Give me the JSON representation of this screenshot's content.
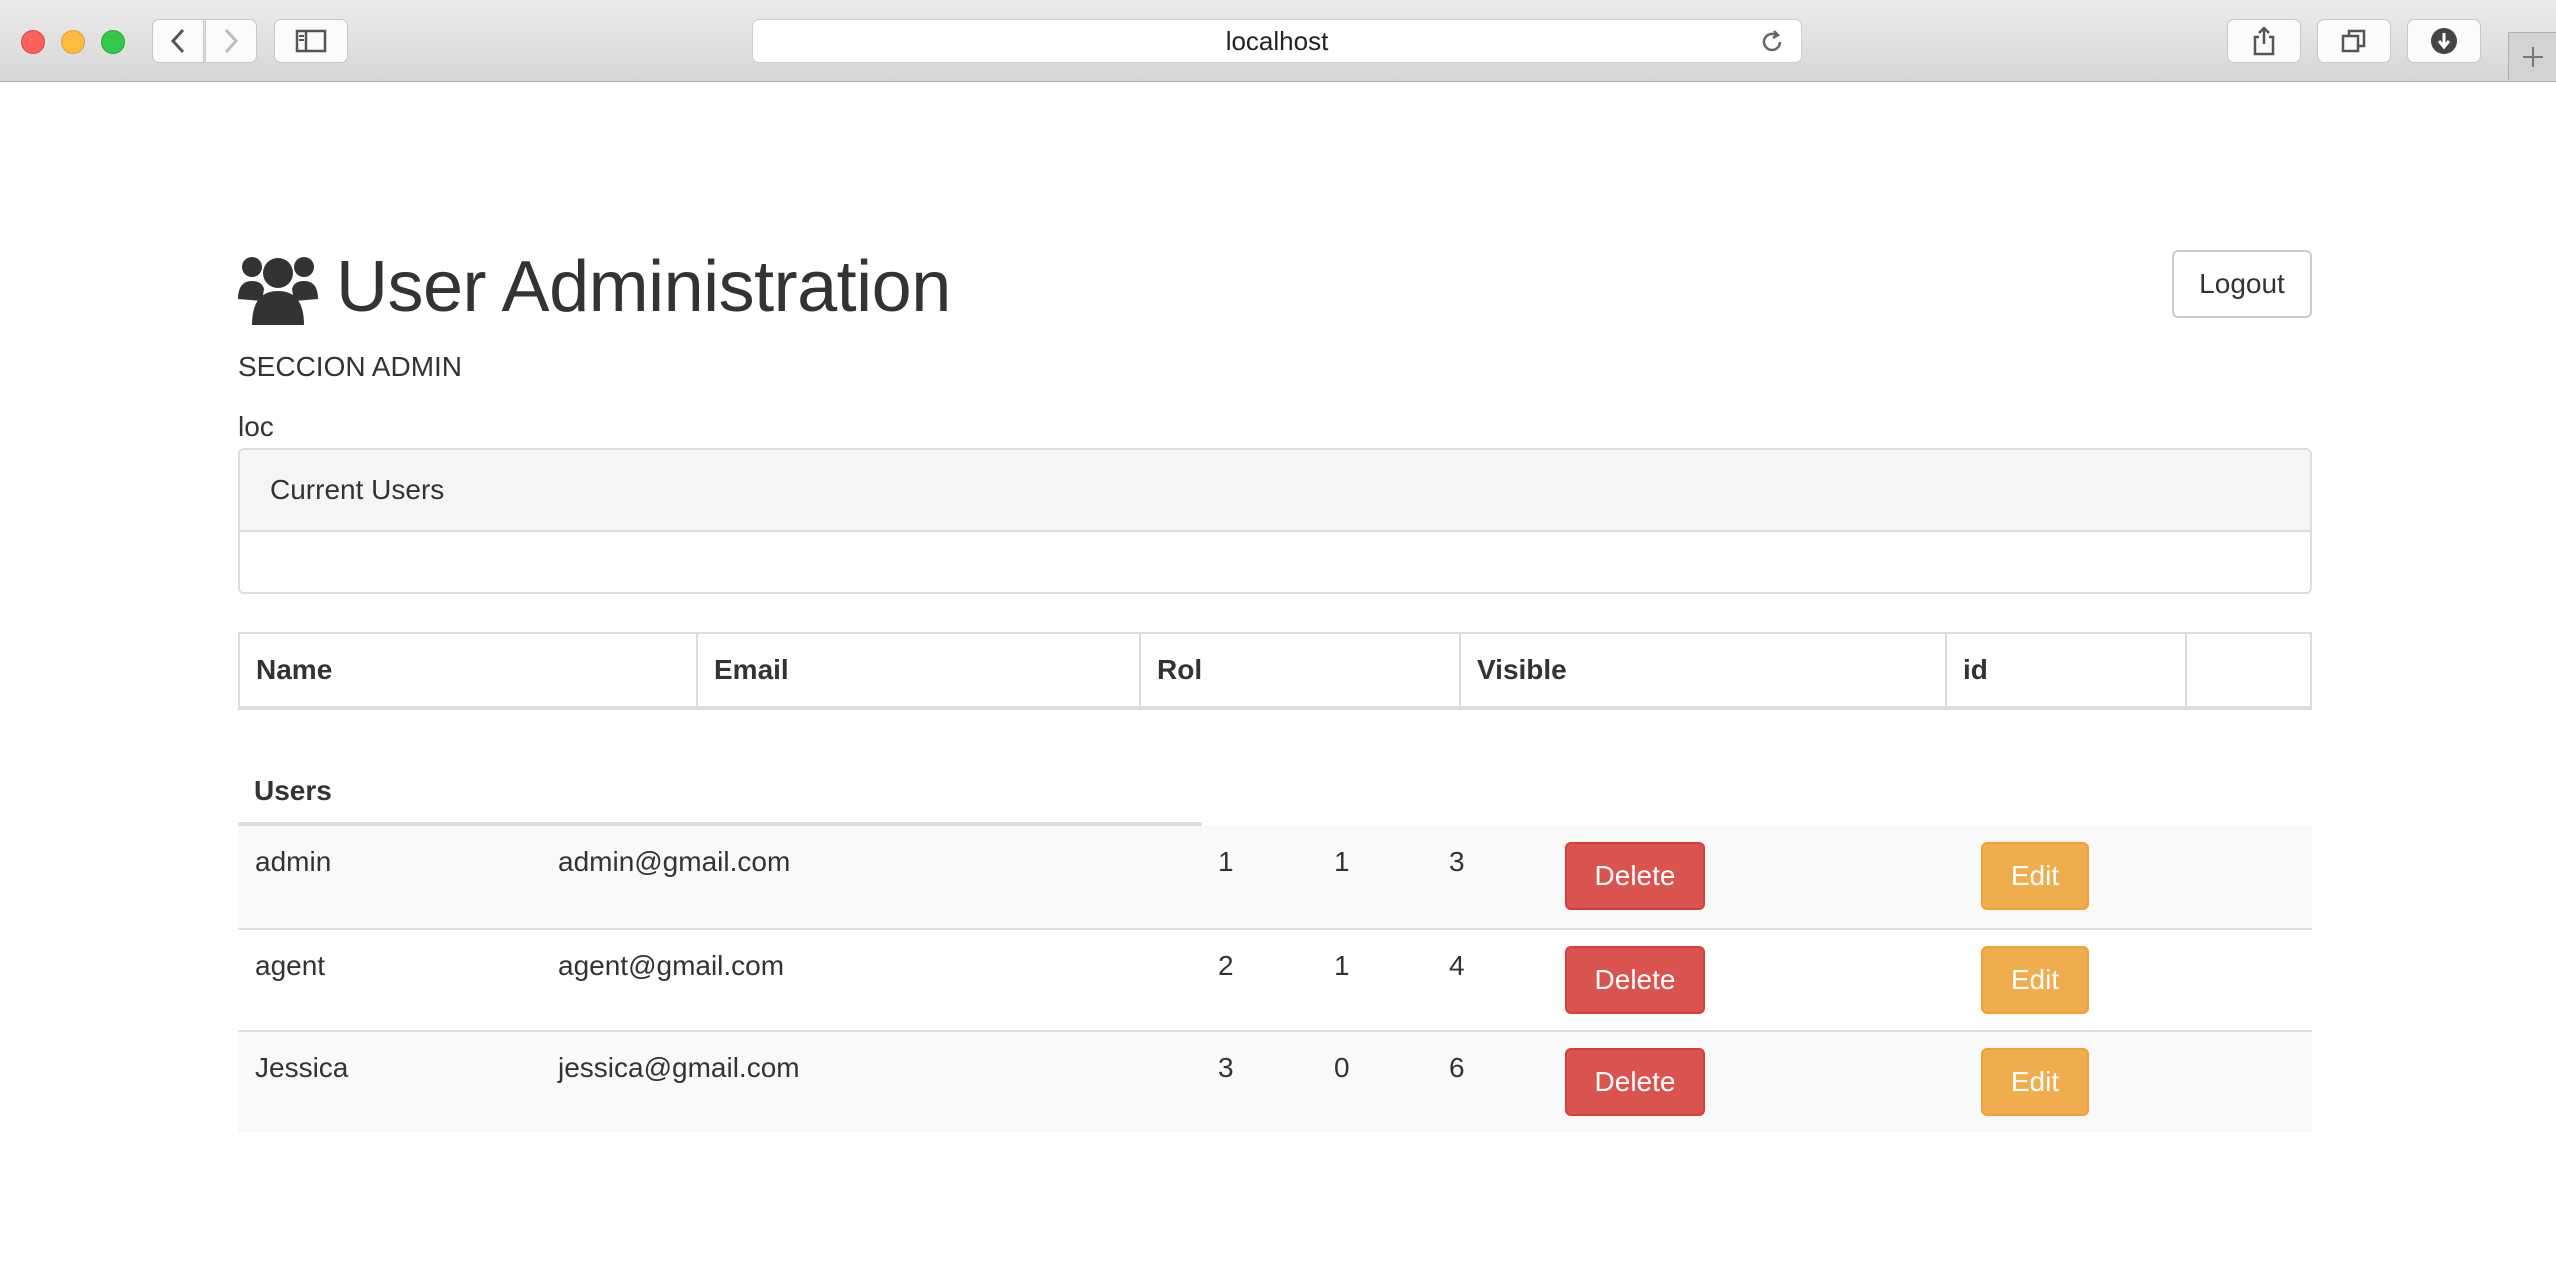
{
  "browser": {
    "url": "localhost"
  },
  "header": {
    "title": "User Administration",
    "logout_label": "Logout",
    "section": "SECCION ADMIN",
    "loc": "loc"
  },
  "panel": {
    "heading": "Current Users"
  },
  "table": {
    "columns": [
      "Name",
      "Email",
      "Rol",
      "Visible",
      "id",
      ""
    ],
    "section_label": "Users",
    "rows": [
      {
        "name": "admin",
        "email": "admin@gmail.com",
        "rol": "1",
        "visible": "1",
        "id": "3",
        "delete": "Delete",
        "edit": "Edit"
      },
      {
        "name": "agent",
        "email": "agent@gmail.com",
        "rol": "2",
        "visible": "1",
        "id": "4",
        "delete": "Delete",
        "edit": "Edit"
      },
      {
        "name": "Jessica",
        "email": "jessica@gmail.com",
        "rol": "3",
        "visible": "0",
        "id": "6",
        "delete": "Delete",
        "edit": "Edit"
      }
    ]
  },
  "colors": {
    "danger": "#d9534f",
    "warning": "#f0ad4e",
    "text": "#333333",
    "border": "#dddddd"
  }
}
